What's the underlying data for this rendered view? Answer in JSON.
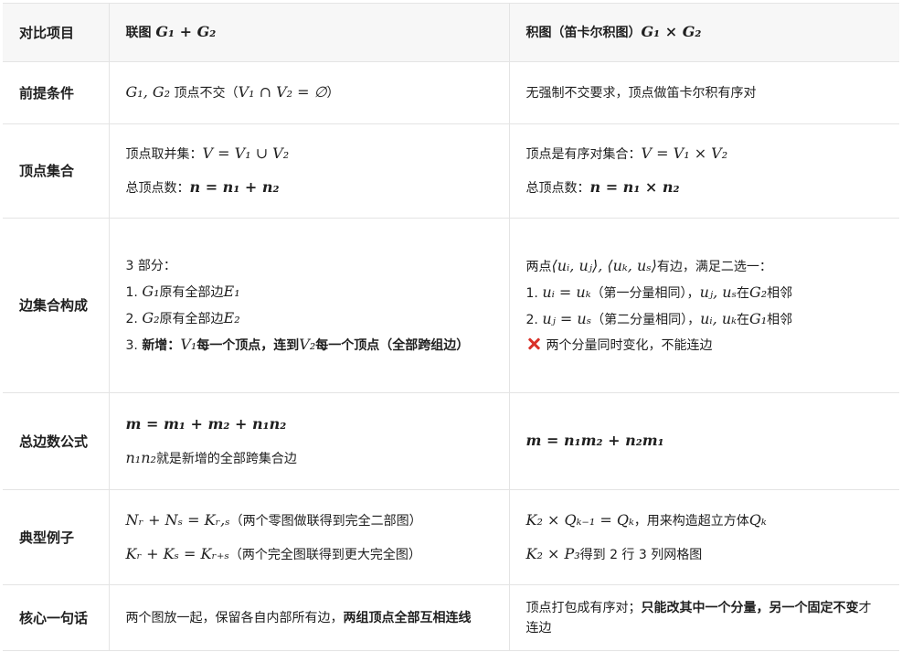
{
  "header": {
    "col1": "对比项目",
    "col2_text": "联图 ",
    "col2_math": "G₁ + G₂",
    "col3_text": "积图（笛卡尔积图）",
    "col3_math": "G₁ × G₂"
  },
  "rows": {
    "premise": {
      "label": "前提条件",
      "join": {
        "math1": "G₁, G₂",
        "text": " 顶点不交（",
        "math2": "V₁ ∩ V₂ = ∅",
        "end": "）"
      },
      "product": "无强制不交要求，顶点做笛卡尔积有序对"
    },
    "vertex": {
      "label": "顶点集合",
      "join_line1_text": "顶点取并集：",
      "join_line1_math": "V = V₁ ∪ V₂",
      "join_line2_text": "总顶点数：",
      "join_line2_math": "n = n₁ + n₂",
      "product_line1_text": "顶点是有序对集合：",
      "product_line1_math": "V = V₁ × V₂",
      "product_line2_text": "总顶点数：",
      "product_line2_math": "n = n₁ × n₂"
    },
    "edges": {
      "label": "边集合构成",
      "join_intro": "3 部分：",
      "join_item1_prefix": "1. ",
      "join_item1_math1": "G₁",
      "join_item1_text": "原有全部边",
      "join_item1_math2": "E₁",
      "join_item2_prefix": "2. ",
      "join_item2_math1": "G₂",
      "join_item2_text": "原有全部边",
      "join_item2_math2": "E₂",
      "join_item3_prefix": "3. ",
      "join_item3_bold_a": "新增：",
      "join_item3_math1": "V₁",
      "join_item3_bold_b": "每一个顶点，连到",
      "join_item3_math2": "V₂",
      "join_item3_bold_c": "每一个顶点（全部跨组边）",
      "product_intro_a": "两点",
      "product_intro_math": "⟨uᵢ, uⱼ⟩, ⟨uₖ, uₛ⟩",
      "product_intro_b": "有边，满足二选一：",
      "product_item1_prefix": "1. ",
      "product_item1_math": "uᵢ = uₖ",
      "product_item1_text": "（第一分量相同），",
      "product_item1_math2": "uⱼ, uₛ",
      "product_item1_text2": "在",
      "product_item1_math3": "G₂",
      "product_item1_text3": "相邻",
      "product_item2_prefix": "2. ",
      "product_item2_math": "uⱼ = uₛ",
      "product_item2_text": "（第二分量相同），",
      "product_item2_math2": "uᵢ, uₖ",
      "product_item2_text2": "在",
      "product_item2_math3": "G₁",
      "product_item2_text3": "相邻",
      "product_note_icon": "cross-mark-icon",
      "product_note": "两个分量同时变化，不能连边"
    },
    "edge_count": {
      "label": "总边数公式",
      "join_formula": "m = m₁ + m₂ + n₁n₂",
      "join_note_math": "n₁n₂",
      "join_note_text": "就是新增的全部跨集合边",
      "product_formula": "m = n₁m₂ + n₂m₁"
    },
    "examples": {
      "label": "典型例子",
      "join_line1_math": "Nᵣ + Nₛ = Kᵣ,ₛ",
      "join_line1_text": "（两个零图做联得到完全二部图）",
      "join_line2_math": "Kᵣ + Kₛ = Kᵣ₊ₛ",
      "join_line2_text": "（两个完全图联得到更大完全图）",
      "product_line1_math": "K₂ × Qₖ₋₁ = Qₖ",
      "product_line1_text": "，用来构造超立方体",
      "product_line1_math2": "Qₖ",
      "product_line2_math": "K₂ × P₃",
      "product_line2_text": "得到 2 行 3 列网格图"
    },
    "summary": {
      "label": "核心一句话",
      "join_plain": "两个图放一起，保留各自内部所有边，",
      "join_bold": "两组顶点全部互相连线",
      "product_plain_a": "顶点打包成有序对；",
      "product_bold": "只能改其中一个分量，另一个固定不变",
      "product_plain_b": "才连边"
    }
  }
}
